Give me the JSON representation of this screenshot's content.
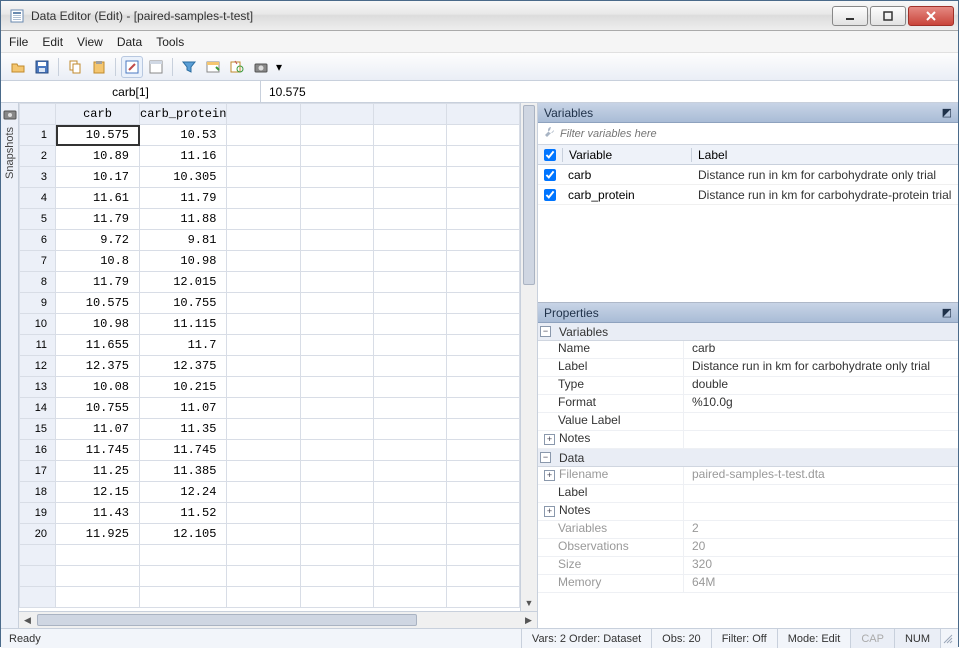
{
  "title": "Data Editor (Edit) - [paired-samples-t-test]",
  "menu": {
    "file": "File",
    "edit": "Edit",
    "view": "View",
    "data": "Data",
    "tools": "Tools"
  },
  "cellref": {
    "name": "carb[1]",
    "value": "10.575"
  },
  "columns": [
    "carb",
    "carb_protein"
  ],
  "rows": [
    {
      "n": "1",
      "carb": "10.575",
      "cp": "10.53"
    },
    {
      "n": "2",
      "carb": "10.89",
      "cp": "11.16"
    },
    {
      "n": "3",
      "carb": "10.17",
      "cp": "10.305"
    },
    {
      "n": "4",
      "carb": "11.61",
      "cp": "11.79"
    },
    {
      "n": "5",
      "carb": "11.79",
      "cp": "11.88"
    },
    {
      "n": "6",
      "carb": "9.72",
      "cp": "9.81"
    },
    {
      "n": "7",
      "carb": "10.8",
      "cp": "10.98"
    },
    {
      "n": "8",
      "carb": "11.79",
      "cp": "12.015"
    },
    {
      "n": "9",
      "carb": "10.575",
      "cp": "10.755"
    },
    {
      "n": "10",
      "carb": "10.98",
      "cp": "11.115"
    },
    {
      "n": "11",
      "carb": "11.655",
      "cp": "11.7"
    },
    {
      "n": "12",
      "carb": "12.375",
      "cp": "12.375"
    },
    {
      "n": "13",
      "carb": "10.08",
      "cp": "10.215"
    },
    {
      "n": "14",
      "carb": "10.755",
      "cp": "11.07"
    },
    {
      "n": "15",
      "carb": "11.07",
      "cp": "11.35"
    },
    {
      "n": "16",
      "carb": "11.745",
      "cp": "11.745"
    },
    {
      "n": "17",
      "carb": "11.25",
      "cp": "11.385"
    },
    {
      "n": "18",
      "carb": "12.15",
      "cp": "12.24"
    },
    {
      "n": "19",
      "carb": "11.43",
      "cp": "11.52"
    },
    {
      "n": "20",
      "carb": "11.925",
      "cp": "12.105"
    }
  ],
  "snapshots_label": "Snapshots",
  "variables_pane": {
    "title": "Variables",
    "filter_placeholder": "Filter variables here",
    "col_variable": "Variable",
    "col_label": "Label",
    "items": [
      {
        "name": "carb",
        "label": "Distance run in km for carbohydrate only trial"
      },
      {
        "name": "carb_protein",
        "label": "Distance run in km for carbohydrate-protein trial"
      }
    ]
  },
  "properties_pane": {
    "title": "Properties",
    "grp_variables": "Variables",
    "grp_data": "Data",
    "name_k": "Name",
    "name_v": "carb",
    "label_k": "Label",
    "label_v": "Distance run in km for carbohydrate only trial",
    "type_k": "Type",
    "type_v": "double",
    "format_k": "Format",
    "format_v": "%10.0g",
    "vlabel_k": "Value Label",
    "vlabel_v": "",
    "notes_k": "Notes",
    "fname_k": "Filename",
    "fname_v": "paired-samples-t-test.dta",
    "dlabel_k": "Label",
    "dlabel_v": "",
    "dnotes_k": "Notes",
    "vars_k": "Variables",
    "vars_v": "2",
    "obs_k": "Observations",
    "obs_v": "20",
    "size_k": "Size",
    "size_v": "320",
    "mem_k": "Memory",
    "mem_v": "64M"
  },
  "status": {
    "ready": "Ready",
    "vars": "Vars: 2  Order: Dataset",
    "obs": "Obs: 20",
    "filter": "Filter: Off",
    "mode": "Mode: Edit",
    "cap": "CAP",
    "num": "NUM"
  }
}
